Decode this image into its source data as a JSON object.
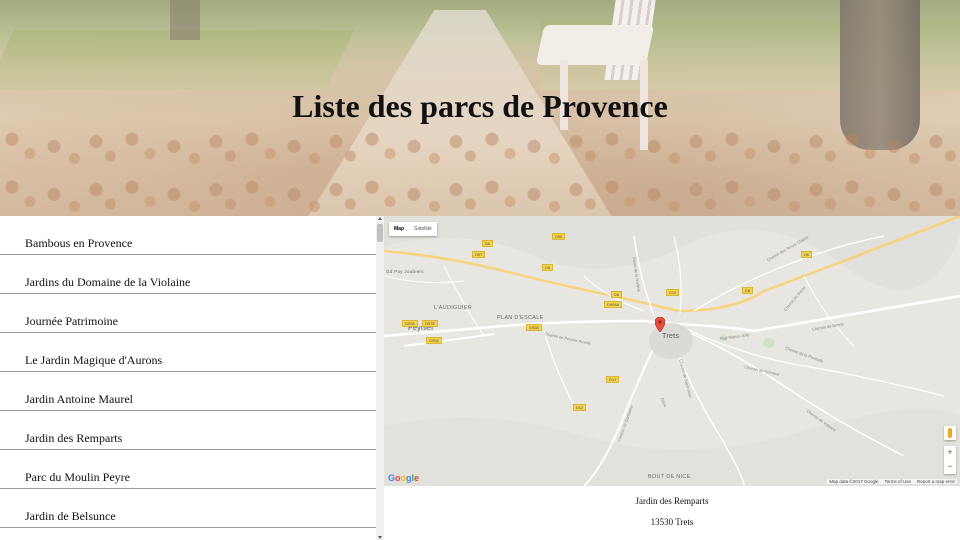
{
  "header": {
    "title": "Liste des parcs de Provence"
  },
  "parks": [
    {
      "label": "Bambous en Provence"
    },
    {
      "label": "Jardins du Domaine de la Violaine"
    },
    {
      "label": "Journée Patrimoine"
    },
    {
      "label": "Le Jardin Magique d'Aurons"
    },
    {
      "label": "Jardin Antoine Maurel"
    },
    {
      "label": "Jardin des Remparts"
    },
    {
      "label": "Parc du Moulin Peyre"
    },
    {
      "label": "Jardin de Belsunce"
    }
  ],
  "map": {
    "type_map": "Map",
    "type_satellite": "Satellite",
    "places": {
      "audiguier": "L'AUDIGUIER",
      "plan_escale": "PLAN D'ESCALE",
      "peynier": "Peynier",
      "trets": "Trets",
      "bout_de_nice": "BOUT DE NICE",
      "puy_joubiers": "Gd Puy Joubiers"
    },
    "roads": [
      "D6",
      "D56",
      "D57",
      "D6",
      "D6",
      "D12",
      "D6",
      "D908A",
      "D908",
      "D57E",
      "D908",
      "D908",
      "D6",
      "D12",
      "D12",
      "D6"
    ],
    "streets": {
      "s1": "Chemin de Peynier Arnelle",
      "s2": "D624",
      "s3": "Chemin de Gardanne",
      "s4": "Chemin de Saint-Jean",
      "s5": "Chemin de Bende",
      "s6": "Chemin de la Plantade",
      "s7": "Chemin de Grimaud",
      "s8": "Chemin de Valonne",
      "s9": "Rue Marius Jolly",
      "s10": "Route de la Burlière",
      "s11": "Chemin des Terres Claires",
      "s12": "Chemin de Berne"
    },
    "zoom_in": "+",
    "zoom_out": "−",
    "google_logo": "Google",
    "map_data": "Map data ©2017 Google",
    "terms": "Terms of Use",
    "report": "Report a map error",
    "pin_color": "#e74c3c"
  },
  "details": {
    "name": "Jardin des Remparts",
    "address": "13530 Trets"
  }
}
